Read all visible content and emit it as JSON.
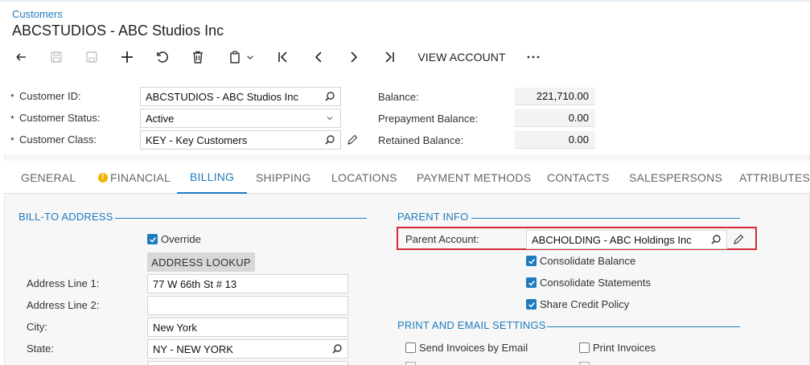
{
  "breadcrumb": "Customers",
  "title": "ABCSTUDIOS - ABC Studios Inc",
  "toolbar": {
    "view_account": "VIEW ACCOUNT"
  },
  "summary": {
    "customer_id_label": "Customer ID:",
    "customer_id_value": "ABCSTUDIOS - ABC Studios Inc",
    "customer_status_label": "Customer Status:",
    "customer_status_value": "Active",
    "customer_class_label": "Customer Class:",
    "customer_class_value": "KEY - Key Customers",
    "balance_label": "Balance:",
    "balance_value": "221,710.00",
    "prepayment_label": "Prepayment Balance:",
    "prepayment_value": "0.00",
    "retained_label": "Retained Balance:",
    "retained_value": "0.00",
    "required_mark": "*"
  },
  "tabs": [
    "GENERAL",
    "FINANCIAL",
    "BILLING",
    "SHIPPING",
    "LOCATIONS",
    "PAYMENT METHODS",
    "CONTACTS",
    "SALESPERSONS",
    "ATTRIBUTES"
  ],
  "active_tab": "BILLING",
  "bill_to": {
    "title": "BILL-TO ADDRESS",
    "override_label": "Override",
    "override_checked": true,
    "lookup_label": "ADDRESS LOOKUP",
    "line1_label": "Address Line 1:",
    "line1_value": "77 W 66th St # 13",
    "line2_label": "Address Line 2:",
    "line2_value": "",
    "city_label": "City:",
    "city_value": "New York",
    "state_label": "State:",
    "state_value": "NY - NEW YORK"
  },
  "parent_info": {
    "title": "PARENT INFO",
    "parent_account_label": "Parent Account:",
    "parent_account_value": "ABCHOLDING - ABC Holdings Inc",
    "consolidate_balance": "Consolidate Balance",
    "consolidate_statements": "Consolidate Statements",
    "share_credit_policy": "Share Credit Policy"
  },
  "print_email": {
    "title": "PRINT AND EMAIL SETTINGS",
    "send_invoices_email": "Send Invoices by Email",
    "print_invoices": "Print Invoices"
  },
  "colors": {
    "accent": "#1f7bbf",
    "highlight": "#d42a37",
    "warning": "#f0b400"
  }
}
